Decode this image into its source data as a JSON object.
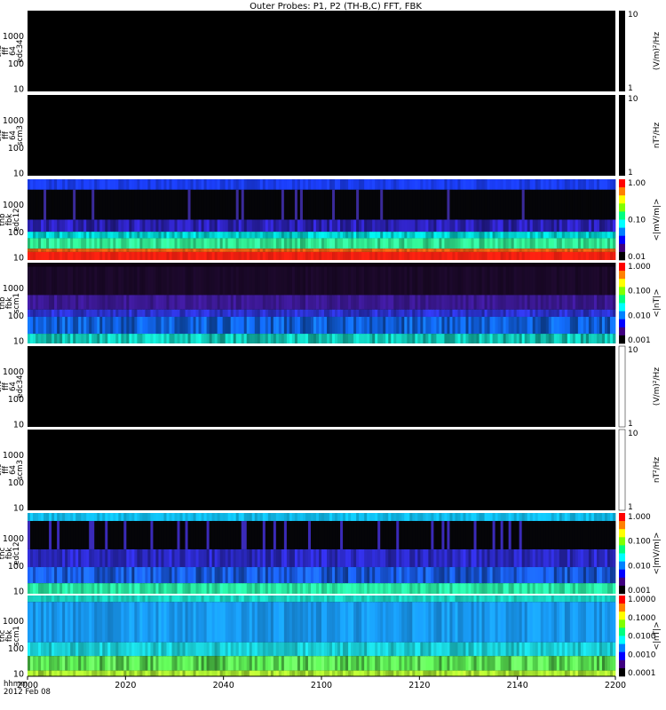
{
  "chart_data": {
    "type": "heatmap",
    "title": "Outer Probes: P1, P2 (TH-B,C) FFT, FBK",
    "x_tick_labels": [
      "2000",
      "2020",
      "2040",
      "2100",
      "2120",
      "2140",
      "2200"
    ],
    "x_corner": {
      "line1": "hhmm",
      "line2": "2012 Feb 08"
    },
    "panels": [
      {
        "id": "thb-fff-edc34",
        "label": [
          "thb",
          "fff",
          "64",
          "edc34"
        ],
        "y_ticks": [
          "1000",
          "100",
          "10"
        ],
        "cb_ticks": [
          "10",
          "1"
        ],
        "cb_units": "(V/m)²/Hz",
        "colorbar_white": false,
        "bands": [],
        "spikes": []
      },
      {
        "id": "thb-fff-scm3",
        "label": [
          "thb",
          "fff",
          "64",
          "scm3"
        ],
        "y_ticks": [
          "1000",
          "100",
          "10"
        ],
        "cb_ticks": [
          "10",
          "1"
        ],
        "cb_units": "nT²/Hz",
        "colorbar_white": false,
        "bands": [],
        "spikes": []
      },
      {
        "id": "thb-fbk-edc12",
        "label": [
          "thb",
          "fbk",
          "edc12"
        ],
        "y_ticks": [
          "1000",
          "100",
          "10"
        ],
        "cb_ticks": [
          "1.00",
          "0.10",
          "0.01"
        ],
        "cb_units": "<|mV/m|>",
        "colorbar_white": false,
        "bands": [
          {
            "y0": 0.0,
            "y1": 0.13,
            "color": "#1a3cf0",
            "noise": 0.35
          },
          {
            "y0": 0.13,
            "y1": 0.5,
            "color": "#050508",
            "noise": 0.15,
            "spike": "#3a2a9a",
            "spikeRate": 0.08
          },
          {
            "y0": 0.5,
            "y1": 0.65,
            "color": "#2a20b0",
            "noise": 0.7
          },
          {
            "y0": 0.65,
            "y1": 0.73,
            "color": "#00c8c8",
            "noise": 0.5
          },
          {
            "y0": 0.73,
            "y1": 0.86,
            "color": "#30e890",
            "noise": 0.5
          },
          {
            "y0": 0.86,
            "y1": 0.9,
            "color": "#e06010",
            "noise": 0.3
          },
          {
            "y0": 0.9,
            "y1": 1.0,
            "color": "#f02010",
            "noise": 0.2
          }
        ],
        "spikes": []
      },
      {
        "id": "thb-fbk-scm1",
        "label": [
          "thb",
          "fbk",
          "scm1"
        ],
        "y_ticks": [
          "1000",
          "100",
          "10"
        ],
        "cb_ticks": [
          "1.000",
          "0.100",
          "0.010",
          "0.001"
        ],
        "cb_units": "<|nT|>",
        "colorbar_white": false,
        "bands": [
          {
            "y0": 0.0,
            "y1": 0.05,
            "color": "#0f0010",
            "noise": 0.2
          },
          {
            "y0": 0.05,
            "y1": 0.4,
            "color": "#1a0828",
            "noise": 0.35
          },
          {
            "y0": 0.4,
            "y1": 0.58,
            "color": "#3a1890",
            "noise": 0.4
          },
          {
            "y0": 0.58,
            "y1": 0.67,
            "color": "#2a30c8",
            "noise": 0.5
          },
          {
            "y0": 0.67,
            "y1": 0.88,
            "color": "#1060e0",
            "noise": 0.8
          },
          {
            "y0": 0.88,
            "y1": 1.0,
            "color": "#10c0b0",
            "noise": 0.6
          }
        ],
        "spikes": []
      },
      {
        "id": "thc-fff-edc34",
        "label": [
          "thc",
          "fff",
          "64",
          "edc34"
        ],
        "y_ticks": [
          "1000",
          "100",
          "10"
        ],
        "cb_ticks": [
          "10",
          "1"
        ],
        "cb_units": "(V/m)²/Hz",
        "colorbar_white": true,
        "bands": [],
        "spikes": []
      },
      {
        "id": "thc-fff-scm3",
        "label": [
          "thc",
          "fff",
          "64",
          "scm3"
        ],
        "y_ticks": [
          "1000",
          "100",
          "10"
        ],
        "cb_ticks": [
          "10",
          "1"
        ],
        "cb_units": "nT²/Hz",
        "colorbar_white": true,
        "bands": [],
        "spikes": []
      },
      {
        "id": "thc-fbk-edc12",
        "label": [
          "thc",
          "fbk",
          "edc12"
        ],
        "y_ticks": [
          "1000",
          "100",
          "10"
        ],
        "cb_ticks": [
          "1.000",
          "0.100",
          "0.010",
          "0.001"
        ],
        "cb_units": "<|mV/m|>",
        "colorbar_white": false,
        "bands": [
          {
            "y0": 0.0,
            "y1": 0.1,
            "color": "#10b8e8",
            "noise": 0.3
          },
          {
            "y0": 0.1,
            "y1": 0.45,
            "color": "#050508",
            "noise": 0.1,
            "spike": "#3a2ab8",
            "spikeRate": 0.12
          },
          {
            "y0": 0.45,
            "y1": 0.67,
            "color": "#2a28c0",
            "noise": 0.6
          },
          {
            "y0": 0.67,
            "y1": 0.87,
            "color": "#1858e0",
            "noise": 0.8
          },
          {
            "y0": 0.87,
            "y1": 1.0,
            "color": "#28e8a0",
            "noise": 0.4
          }
        ],
        "spikes": []
      },
      {
        "id": "thc-fbk-scm1",
        "label": [
          "thc",
          "fbk",
          "scm1"
        ],
        "y_ticks": [
          "1000",
          "100",
          "10"
        ],
        "cb_ticks": [
          "1.0000",
          "0.1000",
          "0.0100",
          "0.0010",
          "0.0001"
        ],
        "cb_units": "<|nT|>",
        "colorbar_white": false,
        "bands": [
          {
            "y0": 0.0,
            "y1": 0.08,
            "color": "#18d0c0",
            "noise": 0.3
          },
          {
            "y0": 0.08,
            "y1": 0.58,
            "color": "#1898f0",
            "noise": 0.35
          },
          {
            "y0": 0.58,
            "y1": 0.75,
            "color": "#18c8d0",
            "noise": 0.4
          },
          {
            "y0": 0.75,
            "y1": 0.93,
            "color": "#58e050",
            "noise": 0.8
          },
          {
            "y0": 0.93,
            "y1": 1.0,
            "color": "#a8e830",
            "noise": 0.5
          }
        ],
        "spikes": []
      }
    ]
  }
}
